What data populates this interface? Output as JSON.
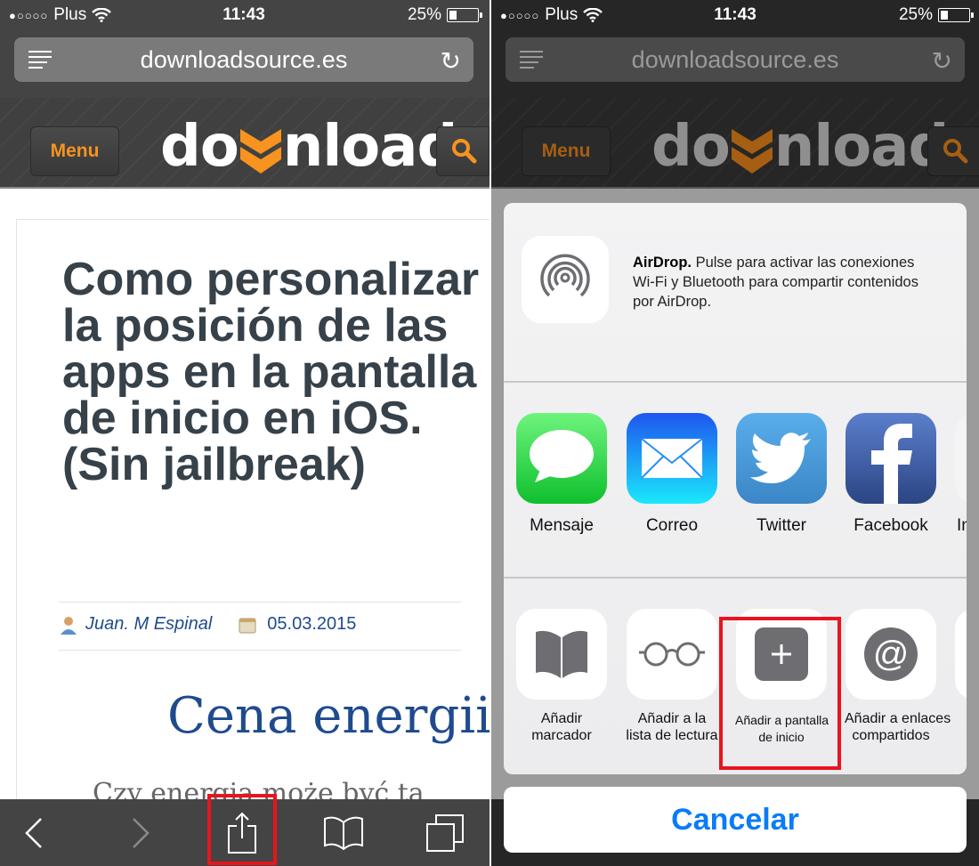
{
  "status_bar": {
    "carrier": "Plus",
    "time": "11:43",
    "battery": "25%",
    "battery_level": 0.25
  },
  "browser": {
    "url": "downloadsource.es"
  },
  "site_header": {
    "menu_label": "Menu",
    "logo_prefix": "do",
    "logo_suffix": "nload",
    "brand_color": "#f7931e"
  },
  "article": {
    "title": "Como personalizar la posición de las apps en la pantalla de inicio en iOS. (Sin jailbreak)",
    "author": "Juan. M Espinal",
    "date": "05.03.2015",
    "heading": "Cena energii",
    "subheading": "Czy energia może być ta"
  },
  "toolbar": {
    "back": "back",
    "forward": "forward",
    "share": "share",
    "bookmarks": "bookmarks",
    "tabs": "tabs"
  },
  "share_sheet": {
    "airdrop": {
      "title": "AirDrop.",
      "text": " Pulse para activar las conexiones Wi-Fi y Bluetooth para compartir contenidos por AirDrop."
    },
    "apps": [
      {
        "label": "Mensaje",
        "icon": "messages-icon"
      },
      {
        "label": "Correo",
        "icon": "mail-icon"
      },
      {
        "label": "Twitter",
        "icon": "twitter-icon"
      },
      {
        "label": "Facebook",
        "icon": "facebook-icon"
      },
      {
        "label": "In",
        "icon": "partial-app-icon"
      }
    ],
    "actions": [
      {
        "label_line1": "Añadir",
        "label_line2": "marcador",
        "icon": "bookmark-icon"
      },
      {
        "label_line1": "Añadir a la",
        "label_line2": "lista de lectura",
        "icon": "reading-list-icon"
      },
      {
        "label_line1": "Añadir a pantalla",
        "label_line2": "de inicio",
        "icon": "add-to-home-icon"
      },
      {
        "label_line1": "Añadir a enlaces",
        "label_line2": "compartidos",
        "icon": "shared-links-icon"
      }
    ],
    "cancel_label": "Cancelar"
  },
  "highlight_color": "#e8141e",
  "accent_color": "#0a7cf7"
}
